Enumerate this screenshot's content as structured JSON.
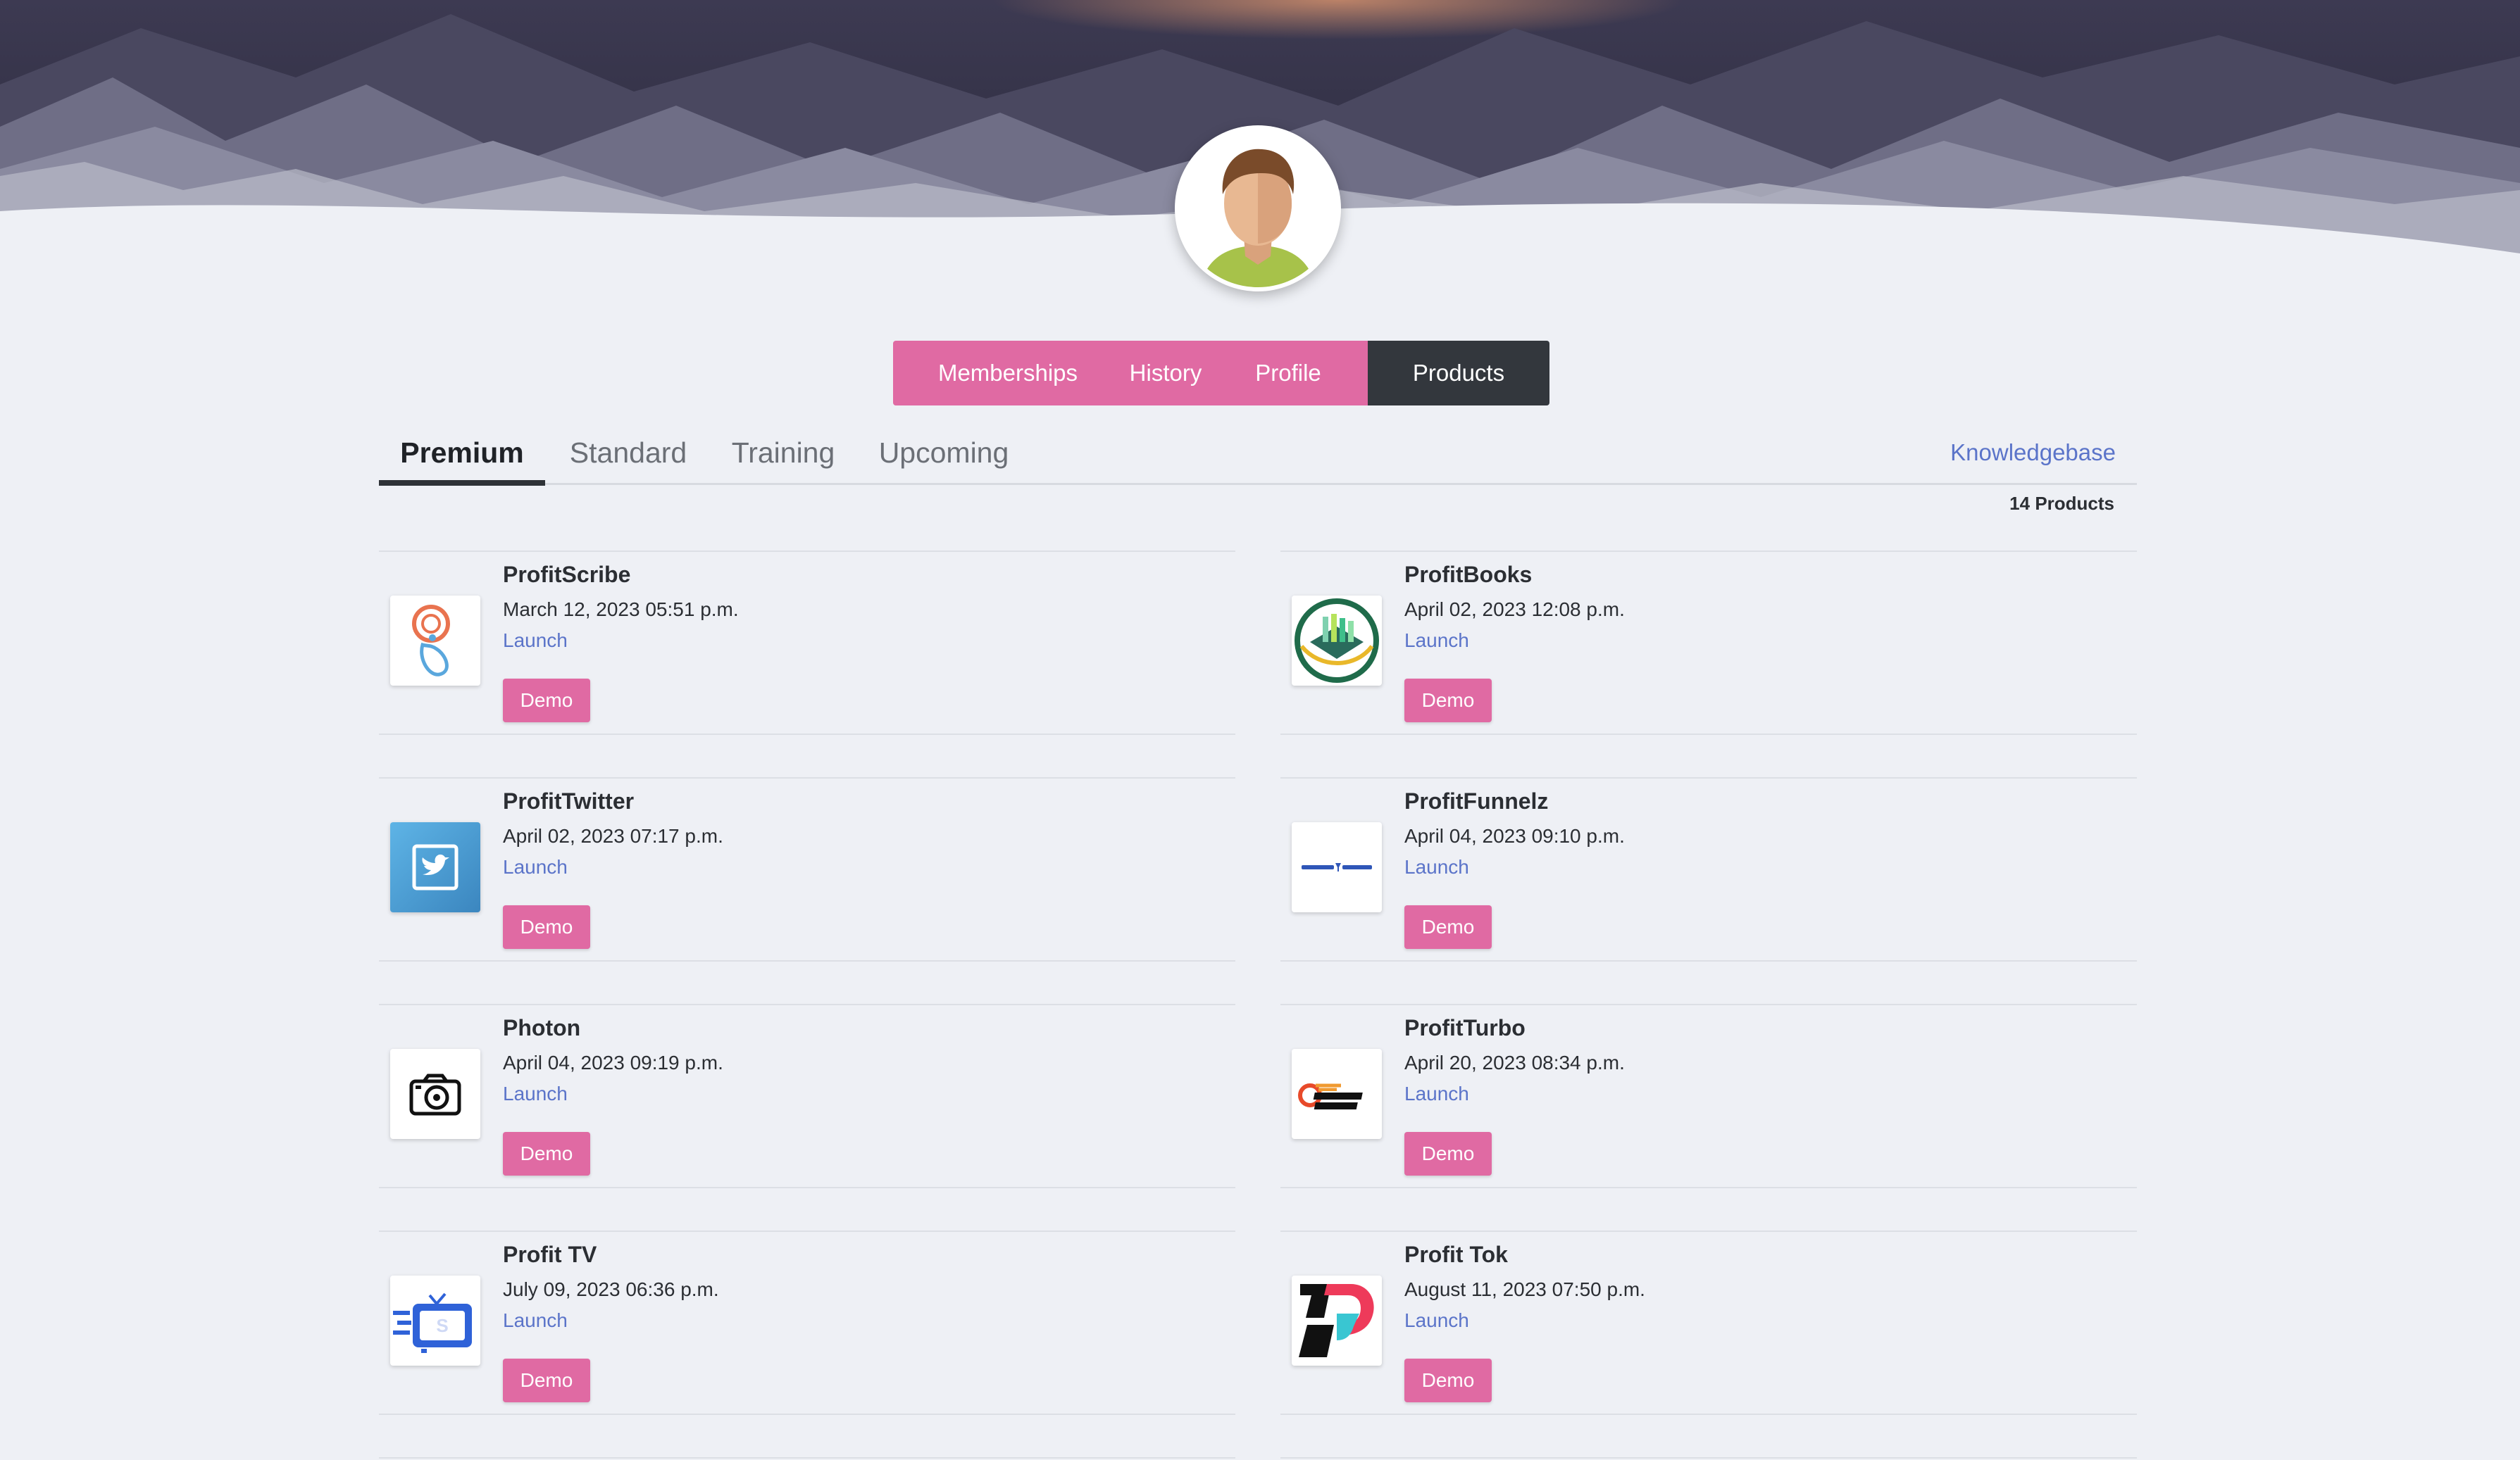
{
  "nav": {
    "items": [
      {
        "label": "Memberships",
        "active": false
      },
      {
        "label": "History",
        "active": false
      },
      {
        "label": "Profile",
        "active": false
      },
      {
        "label": "Products",
        "active": true
      }
    ]
  },
  "tabs": {
    "items": [
      {
        "label": "Premium",
        "active": true
      },
      {
        "label": "Standard",
        "active": false
      },
      {
        "label": "Training",
        "active": false
      },
      {
        "label": "Upcoming",
        "active": false
      }
    ],
    "knowledgebase": "Knowledgebase"
  },
  "products_count": "14 Products",
  "colors": {
    "accent_pink": "#e06aa3",
    "dark": "#33373d",
    "link": "#5b74c9",
    "background": "#eef0f5"
  },
  "products": [
    {
      "name": "ProfitScribe",
      "date": "March 12, 2023 05:51 p.m.",
      "launch": "Launch",
      "demo": "Demo",
      "icon": "profitscribe-icon"
    },
    {
      "name": "ProfitBooks",
      "date": "April 02, 2023 12:08 p.m.",
      "launch": "Launch",
      "demo": "Demo",
      "icon": "profitbooks-icon"
    },
    {
      "name": "ProfitTwitter",
      "date": "April 02, 2023 07:17 p.m.",
      "launch": "Launch",
      "demo": "Demo",
      "icon": "twitter-icon"
    },
    {
      "name": "ProfitFunnelz",
      "date": "April 04, 2023 09:10 p.m.",
      "launch": "Launch",
      "demo": "Demo",
      "icon": "profitfunnelz-icon"
    },
    {
      "name": "Photon",
      "date": "April 04, 2023 09:19 p.m.",
      "launch": "Launch",
      "demo": "Demo",
      "icon": "camera-icon"
    },
    {
      "name": "ProfitTurbo",
      "date": "April 20, 2023 08:34 p.m.",
      "launch": "Launch",
      "demo": "Demo",
      "icon": "profitturbo-icon"
    },
    {
      "name": "Profit TV",
      "date": "July 09, 2023 06:36 p.m.",
      "launch": "Launch",
      "demo": "Demo",
      "icon": "tv-icon"
    },
    {
      "name": "Profit Tok",
      "date": "August 11, 2023 07:50 p.m.",
      "launch": "Launch",
      "demo": "Demo",
      "icon": "profittok-icon"
    }
  ]
}
